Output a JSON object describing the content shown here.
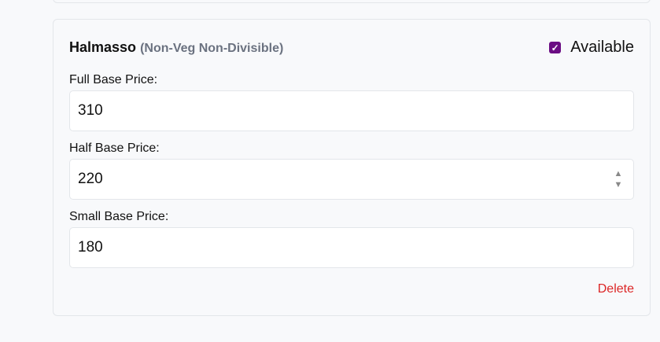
{
  "item": {
    "name": "Halmasso",
    "category": "(Non-Veg Non-Divisible)",
    "available_label": "Available",
    "available": true,
    "fields": [
      {
        "label": "Full Base Price:",
        "value": "310"
      },
      {
        "label": "Half Base Price:",
        "value": "220"
      },
      {
        "label": "Small Base Price:",
        "value": "180"
      }
    ],
    "delete_label": "Delete"
  },
  "colors": {
    "accent": "#6b0d83",
    "danger": "#dc2626"
  }
}
